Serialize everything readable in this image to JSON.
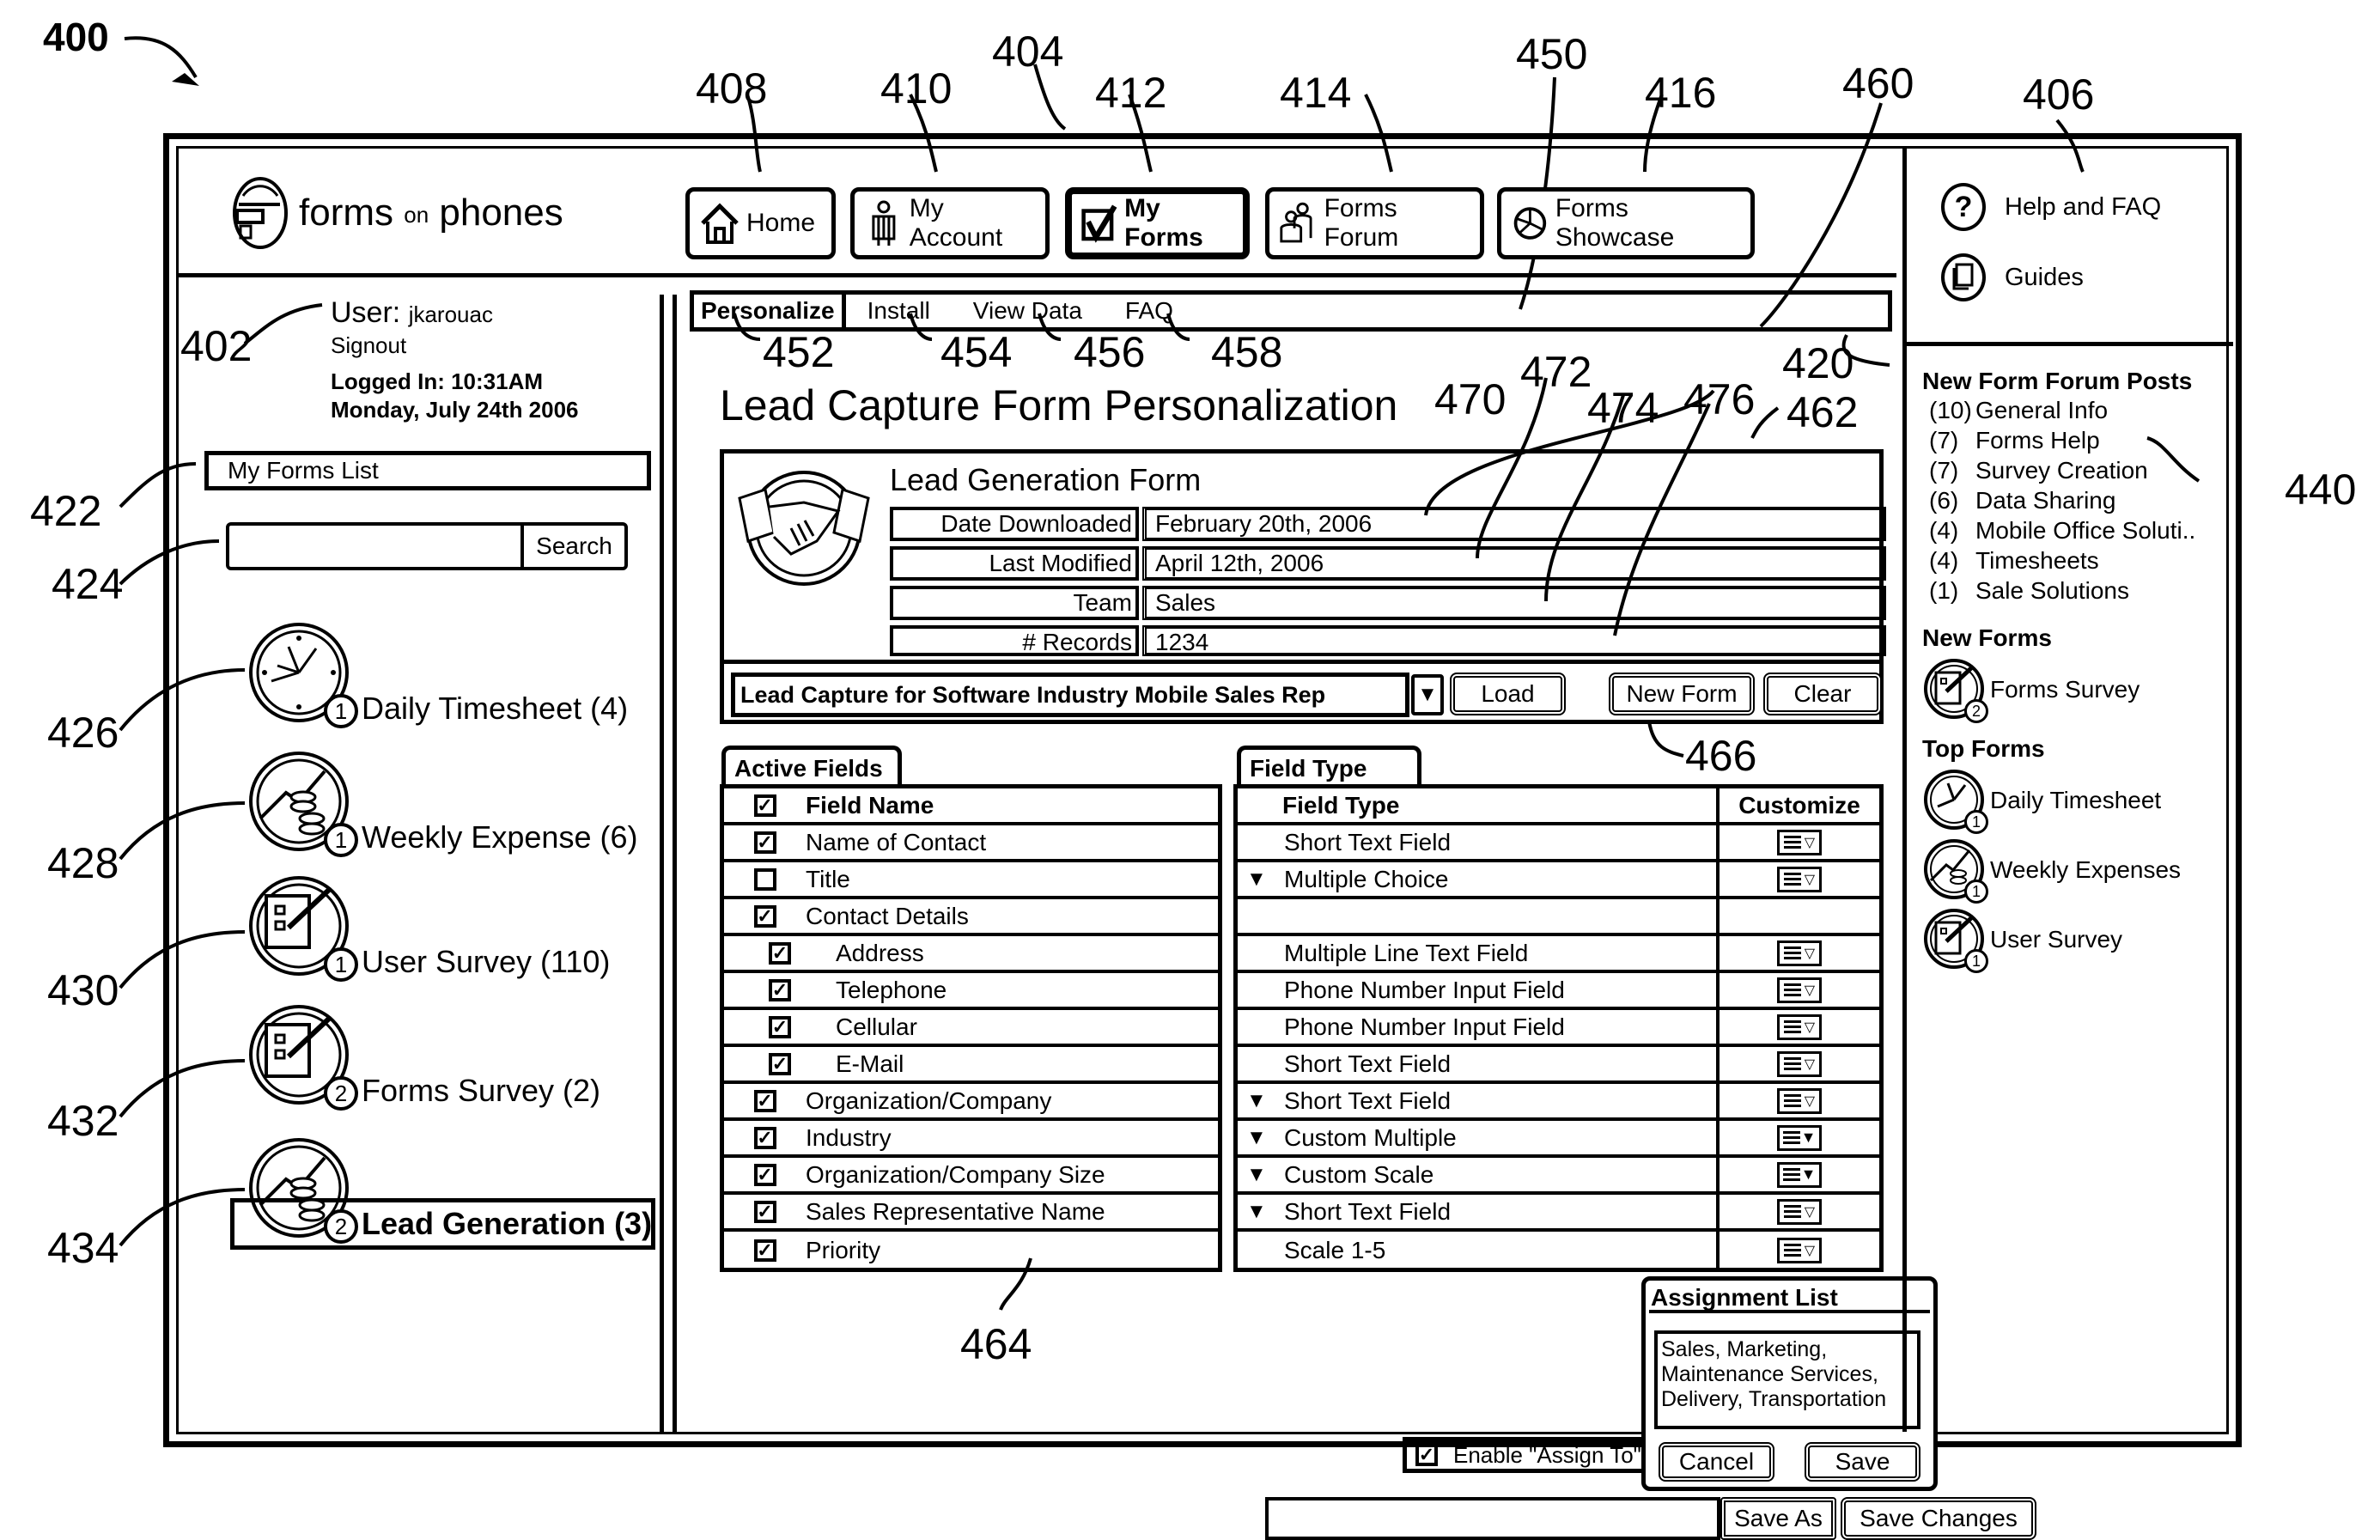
{
  "figure": {
    "ref_main": "400",
    "refs": {
      "r402": "402",
      "r404": "404",
      "r406": "406",
      "r408": "408",
      "r410": "410",
      "r412": "412",
      "r414": "414",
      "r416": "416",
      "r420": "420",
      "r422": "422",
      "r424": "424",
      "r426": "426",
      "r428": "428",
      "r430": "430",
      "r432": "432",
      "r434": "434",
      "r440": "440",
      "r450": "450",
      "r452": "452",
      "r454": "454",
      "r456": "456",
      "r458": "458",
      "r460": "460",
      "r462": "462",
      "r464": "464",
      "r466": "466",
      "r470": "470",
      "r472": "472",
      "r474": "474",
      "r476": "476"
    }
  },
  "header": {
    "logo": {
      "brand_main": "forms",
      "brand_small": "on",
      "brand_tail": "phones",
      "icon": "phone-logo-icon"
    },
    "nav": [
      {
        "label": "Home",
        "icon": "home-icon",
        "active": false
      },
      {
        "label": "My Account",
        "icon": "person-icon",
        "active": false
      },
      {
        "label": "My Forms",
        "icon": "checkbox-icon",
        "active": true
      },
      {
        "label": "Forms Forum",
        "icon": "people-icon",
        "active": false
      },
      {
        "label": "Forms Showcase",
        "icon": "pie-chart-icon",
        "active": false
      }
    ]
  },
  "sidebar": {
    "user_label": "User:",
    "username": "jkarouac",
    "signout": "Signout",
    "logged_in": "Logged In: 10:31AM",
    "date": "Monday, July 24th 2006",
    "forms_list_label": "My Forms List",
    "search": {
      "value": "",
      "placeholder": "",
      "button": "Search"
    },
    "forms": [
      {
        "label": "Daily Timesheet (4)",
        "badge": "1",
        "icon": "clock-icon",
        "selected": false
      },
      {
        "label": "Weekly Expense (6)",
        "badge": "1",
        "icon": "expense-coins-icon",
        "selected": false
      },
      {
        "label": "User Survey (110)",
        "badge": "1",
        "icon": "survey-clipboard-icon",
        "selected": false
      },
      {
        "label": "Forms Survey (2)",
        "badge": "2",
        "icon": "survey-clipboard-icon",
        "selected": false
      },
      {
        "label": "Lead Generation (3)",
        "badge": "2",
        "icon": "expense-coins-icon",
        "selected": true
      }
    ]
  },
  "main": {
    "tabs": [
      {
        "label": "Personalize",
        "active": true
      },
      {
        "label": "Install",
        "active": false
      },
      {
        "label": "View Data",
        "active": false
      },
      {
        "label": "FAQ",
        "active": false
      }
    ],
    "title": "Lead Capture Form Personalization",
    "form_info": {
      "name": "Lead Generation Form",
      "icon": "handshake-icon",
      "rows": [
        {
          "label": "Date Downloaded",
          "value": "February 20th, 2006"
        },
        {
          "label": "Last Modified",
          "value": "April 12th, 2006"
        },
        {
          "label": "Team",
          "value": "Sales"
        },
        {
          "label": "# Records",
          "value": "1234"
        }
      ]
    },
    "template_select": {
      "value": "Lead Capture for Software Industry Mobile Sales Rep"
    },
    "buttons": {
      "load": "Load",
      "new_form": "New Form",
      "clear": "Clear",
      "save_as": "Save As",
      "save_changes": "Save Changes"
    },
    "active_fields": {
      "tab_label": "Active Fields",
      "header": "Field Name",
      "rows": [
        {
          "name": "Name of Contact",
          "checked": true,
          "indent": false
        },
        {
          "name": "Title",
          "checked": false,
          "indent": false
        },
        {
          "name": "Contact Details",
          "checked": true,
          "indent": false
        },
        {
          "name": "Address",
          "checked": true,
          "indent": true
        },
        {
          "name": "Telephone",
          "checked": true,
          "indent": true
        },
        {
          "name": "Cellular",
          "checked": true,
          "indent": true
        },
        {
          "name": "E-Mail",
          "checked": true,
          "indent": true
        },
        {
          "name": "Organization/Company",
          "checked": true,
          "indent": false
        },
        {
          "name": "Industry",
          "checked": true,
          "indent": false
        },
        {
          "name": "Organization/Company Size",
          "checked": true,
          "indent": false
        },
        {
          "name": "Sales Representative Name",
          "checked": true,
          "indent": false
        },
        {
          "name": "Priority",
          "checked": true,
          "indent": false
        }
      ]
    },
    "field_types": {
      "tab_label": "Field Type",
      "header_type": "Field Type",
      "header_customize": "Customize",
      "rows": [
        {
          "type": "Short Text Field",
          "dropdown": false,
          "customize": "light"
        },
        {
          "type": "Multiple Choice",
          "dropdown": true,
          "customize": "light"
        },
        {
          "type": "",
          "dropdown": false,
          "customize": ""
        },
        {
          "type": "Multiple Line Text Field",
          "dropdown": false,
          "customize": "light"
        },
        {
          "type": "Phone Number Input Field",
          "dropdown": false,
          "customize": "light"
        },
        {
          "type": "Phone Number Input Field",
          "dropdown": false,
          "customize": "light"
        },
        {
          "type": "Short Text Field",
          "dropdown": false,
          "customize": "light"
        },
        {
          "type": "Short Text Field",
          "dropdown": true,
          "customize": "light"
        },
        {
          "type": "Custom Multiple",
          "dropdown": true,
          "customize": "dark"
        },
        {
          "type": "Custom Scale",
          "dropdown": true,
          "customize": "dark"
        },
        {
          "type": "Short Text Field",
          "dropdown": true,
          "customize": "light"
        },
        {
          "type": "Scale 1-5",
          "dropdown": false,
          "customize": "light"
        }
      ]
    },
    "enable_assign": {
      "label": "Enable \"Assign To\"",
      "checked": true
    },
    "save_as_input": {
      "value": ""
    },
    "assignment_popup": {
      "title": "Assignment List",
      "text": "Sales, Marketing, Maintenance Services, Delivery, Transportation",
      "cancel": "Cancel",
      "save": "Save"
    }
  },
  "right_panel": {
    "links": [
      {
        "label": "Help and FAQ",
        "icon": "help-question-icon"
      },
      {
        "label": "Guides",
        "icon": "guides-document-icon"
      }
    ],
    "forum_posts_title": "New Form Forum Posts",
    "forum_posts": [
      {
        "count": "(10)",
        "label": "General Info"
      },
      {
        "count": "(7)",
        "label": "Forms Help"
      },
      {
        "count": "(7)",
        "label": "Survey Creation"
      },
      {
        "count": "(6)",
        "label": "Data Sharing"
      },
      {
        "count": "(4)",
        "label": "Mobile Office Soluti.."
      },
      {
        "count": "(4)",
        "label": "Timesheets"
      },
      {
        "count": "(1)",
        "label": "Sale Solutions"
      }
    ],
    "new_forms_title": "New Forms",
    "new_forms": [
      {
        "label": "Forms Survey",
        "badge": "2",
        "icon": "survey-clipboard-icon"
      }
    ],
    "top_forms_title": "Top Forms",
    "top_forms": [
      {
        "label": "Daily Timesheet",
        "badge": "1",
        "icon": "clock-icon"
      },
      {
        "label": "Weekly Expenses",
        "badge": "1",
        "icon": "expense-coins-icon"
      },
      {
        "label": "User Survey",
        "badge": "1",
        "icon": "survey-clipboard-icon"
      }
    ]
  }
}
